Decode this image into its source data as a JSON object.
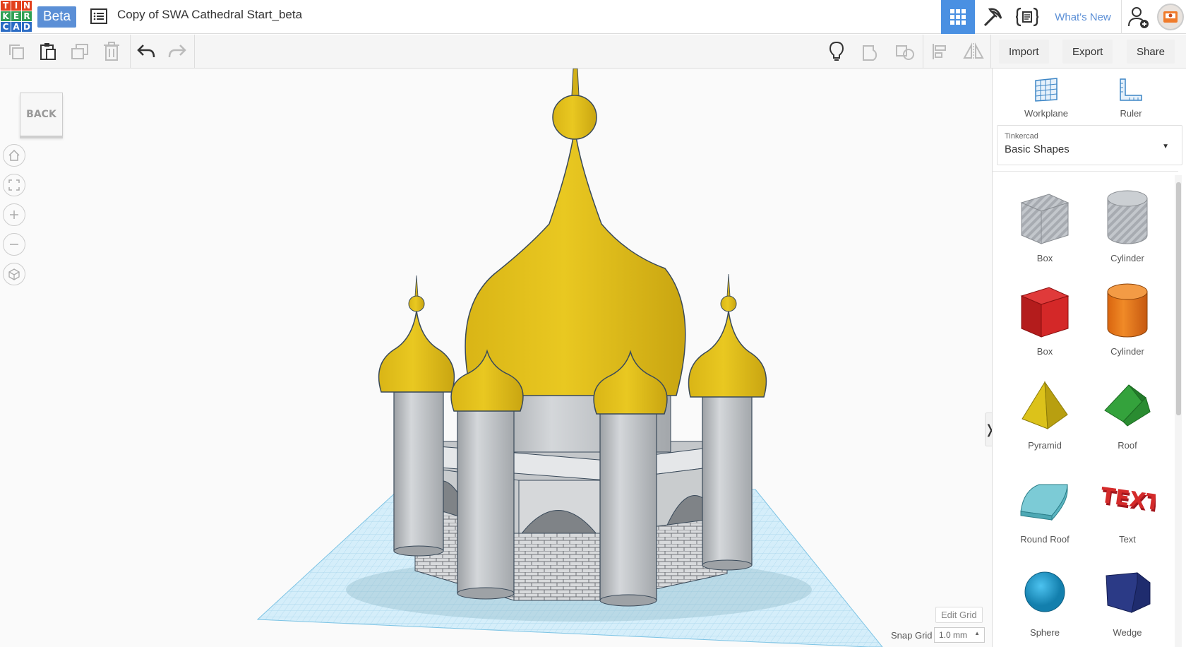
{
  "header": {
    "logo_letters": [
      "T",
      "I",
      "N",
      "K",
      "E",
      "R",
      "C",
      "A",
      "D"
    ],
    "logo_colors": [
      "#e2401c",
      "#e2401c",
      "#e2401c",
      "#2f9f53",
      "#2f9f53",
      "#2f9f53",
      "#2b6cc4",
      "#2b6cc4",
      "#2b6cc4"
    ],
    "beta_label": "Beta",
    "doc_title": "Copy of SWA Cathedral Start_beta",
    "whats_new": "What's New",
    "accent": "#4a90e2"
  },
  "toolbar": {
    "import_label": "Import",
    "export_label": "Export",
    "share_label": "Share"
  },
  "viewport": {
    "back_label": "BACK",
    "edit_grid_label": "Edit Grid",
    "snap_grid_label": "Snap Grid",
    "snap_grid_value": "1.0 mm"
  },
  "panel": {
    "workplane_label": "Workplane",
    "ruler_label": "Ruler",
    "library_source": "Tinkercad",
    "library_name": "Basic Shapes",
    "shapes": [
      {
        "label": "Box",
        "icon": "box-hole-icon"
      },
      {
        "label": "Cylinder",
        "icon": "cylinder-hole-icon"
      },
      {
        "label": "Box",
        "icon": "box-icon"
      },
      {
        "label": "Cylinder",
        "icon": "cylinder-icon"
      },
      {
        "label": "Pyramid",
        "icon": "pyramid-icon"
      },
      {
        "label": "Roof",
        "icon": "roof-icon"
      },
      {
        "label": "Round Roof",
        "icon": "round-roof-icon"
      },
      {
        "label": "Text",
        "icon": "text-icon"
      },
      {
        "label": "Sphere",
        "icon": "sphere-icon"
      },
      {
        "label": "Wedge",
        "icon": "wedge-icon"
      }
    ]
  }
}
